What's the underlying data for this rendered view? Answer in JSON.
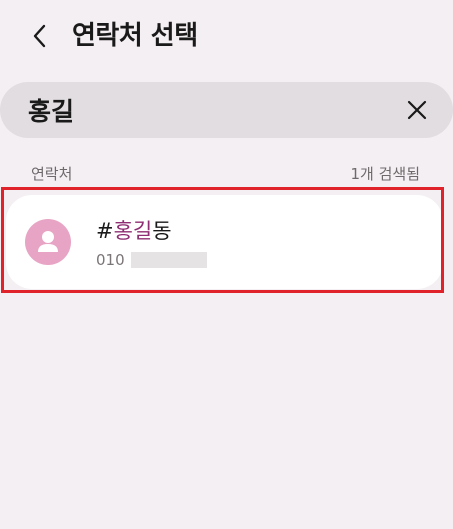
{
  "header": {
    "title": "연락처 선택",
    "back_icon": "chevron-left-icon"
  },
  "search": {
    "query": "홍길",
    "clear_icon": "close-icon"
  },
  "results": {
    "section_label": "연락처",
    "count_label": "1개 검색됨"
  },
  "contacts": [
    {
      "name_prefix": "#",
      "name_match": "홍길",
      "name_suffix": "동",
      "phone": "010",
      "avatar_icon": "person-icon"
    }
  ],
  "colors": {
    "background": "#f4eff2",
    "search_bar": "#e2dde0",
    "highlight": "#8e2d73",
    "avatar": "#e8a4c5",
    "selection_frame": "#e0222b"
  }
}
